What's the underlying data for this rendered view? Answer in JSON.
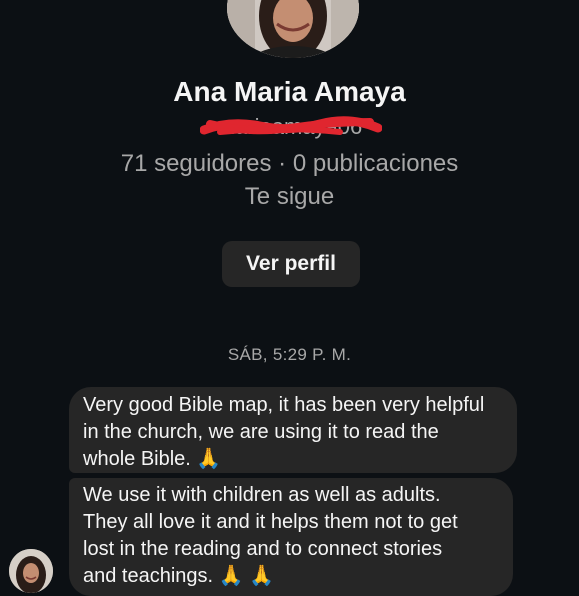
{
  "profile": {
    "name": "Ana Maria Amaya",
    "username": "mariaamaya06",
    "stats": "71 seguidores · 0 publicaciones",
    "follows_status": "Te sigue",
    "view_profile_label": "Ver perfil",
    "username_redacted": true,
    "redaction_color": "#e0262f"
  },
  "conversation": {
    "timestamp": "SÁB, 5:29 P. M.",
    "messages": [
      {
        "lines": [
          "Very good Bible map, it has been very helpful",
          "in the church, we are using it to read the",
          "whole Bible. 🙏"
        ]
      },
      {
        "lines": [
          "We use it with children as well as adults.",
          "They all love it and it helps them not to get",
          "lost in the reading and to connect stories",
          "and teachings. 🙏 🙏"
        ]
      }
    ]
  },
  "colors": {
    "background": "#0c1014",
    "bubble": "#262626",
    "text_primary": "#f5f5f5",
    "text_secondary": "#a8a8a8"
  },
  "icons": {
    "emoji": "folded-hands"
  }
}
